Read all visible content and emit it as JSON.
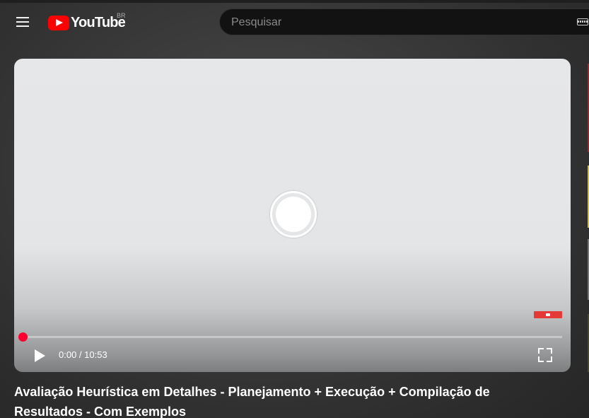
{
  "header": {
    "menu_icon": "hamburger-menu-icon",
    "logo_text": "YouTube",
    "logo_region": "BR",
    "search_placeholder": "Pesquisar",
    "keyboard_icon": "keyboard-icon"
  },
  "player": {
    "loading_icon": "loading-spinner-icon",
    "current_time": "0:00",
    "duration": "10:53",
    "time_display": "0:00 / 10:53",
    "progress_fraction": 0.0,
    "play_icon": "play-icon",
    "fullscreen_icon": "fullscreen-icon",
    "watermark_icon": "channel-watermark-icon"
  },
  "video": {
    "title": "Avaliação Heurística em Detalhes - Planejamento + Execução + Compilação de Resultados - Com Exemplos"
  },
  "colors": {
    "accent": "#ff0033",
    "logo_red": "#ff0000",
    "background": "#2e2e2e"
  }
}
